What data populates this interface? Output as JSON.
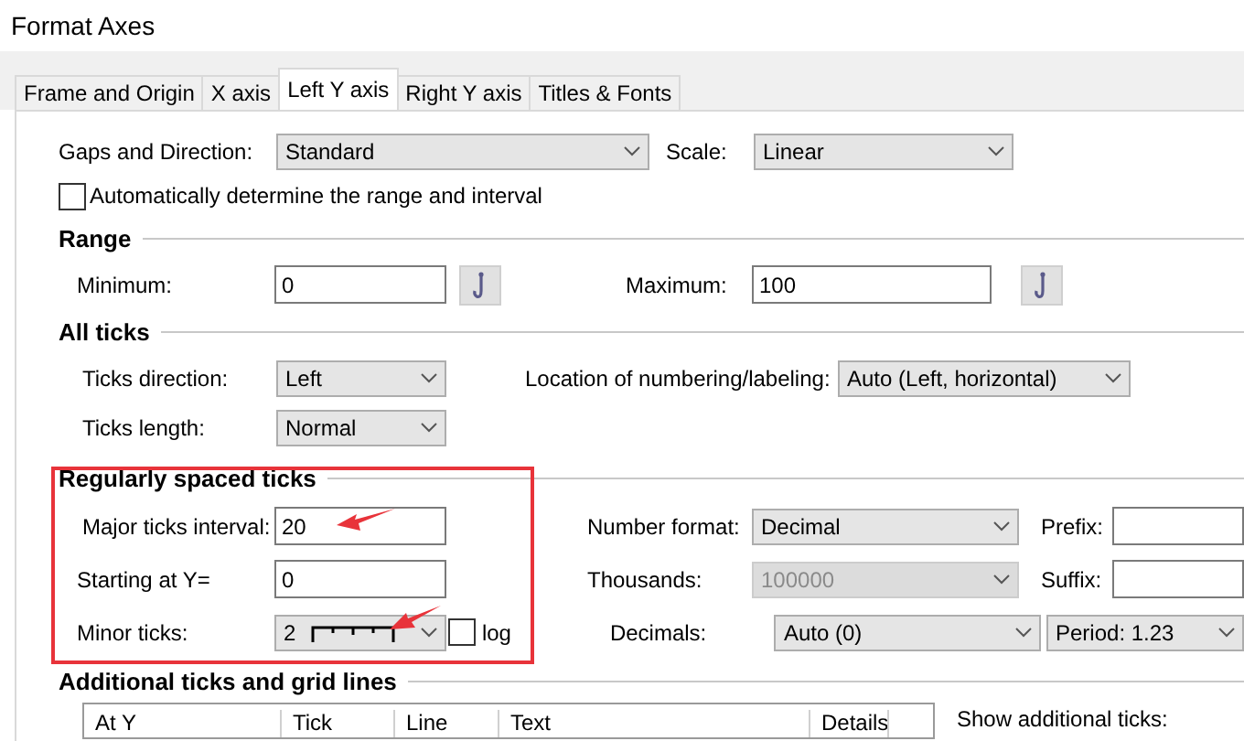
{
  "window": {
    "title": "Format Axes"
  },
  "tabs": [
    {
      "label": "Frame and Origin",
      "selected": false
    },
    {
      "label": "X axis",
      "selected": false
    },
    {
      "label": "Left Y axis",
      "selected": true
    },
    {
      "label": "Right Y axis",
      "selected": false
    },
    {
      "label": "Titles & Fonts",
      "selected": false
    }
  ],
  "gaps": {
    "label": "Gaps and Direction:",
    "value": "Standard"
  },
  "scale": {
    "label": "Scale:",
    "value": "Linear"
  },
  "auto_range": {
    "label": "Automatically determine the range and interval",
    "checked": false
  },
  "range": {
    "title": "Range",
    "minimum": {
      "label": "Minimum:",
      "value": "0"
    },
    "maximum": {
      "label": "Maximum:",
      "value": "100"
    }
  },
  "all_ticks": {
    "title": "All ticks",
    "direction": {
      "label": "Ticks direction:",
      "value": "Left"
    },
    "location": {
      "label": "Location of numbering/labeling:",
      "value": "Auto (Left, horizontal)"
    },
    "length": {
      "label": "Ticks length:",
      "value": "Normal"
    }
  },
  "regular_ticks": {
    "title": "Regularly spaced ticks",
    "major_interval": {
      "label": "Major ticks interval:",
      "value": "20"
    },
    "starting_at": {
      "label": "Starting at Y=",
      "value": "0"
    },
    "minor_ticks": {
      "label": "Minor ticks:",
      "value": "2"
    },
    "log": {
      "label": "log",
      "checked": false
    }
  },
  "number_format": {
    "label": "Number format:",
    "value": "Decimal"
  },
  "thousands": {
    "label": "Thousands:",
    "value": "100000",
    "disabled": true
  },
  "decimals": {
    "label": "Decimals:",
    "value": "Auto (0)"
  },
  "prefix": {
    "label": "Prefix:"
  },
  "suffix": {
    "label": "Suffix:"
  },
  "period": {
    "value": "Period: 1.23"
  },
  "additional": {
    "title": "Additional ticks and grid lines",
    "columns": [
      "At Y",
      "Tick",
      "Line",
      "Text",
      "Details"
    ],
    "show_label": "Show additional ticks:"
  }
}
